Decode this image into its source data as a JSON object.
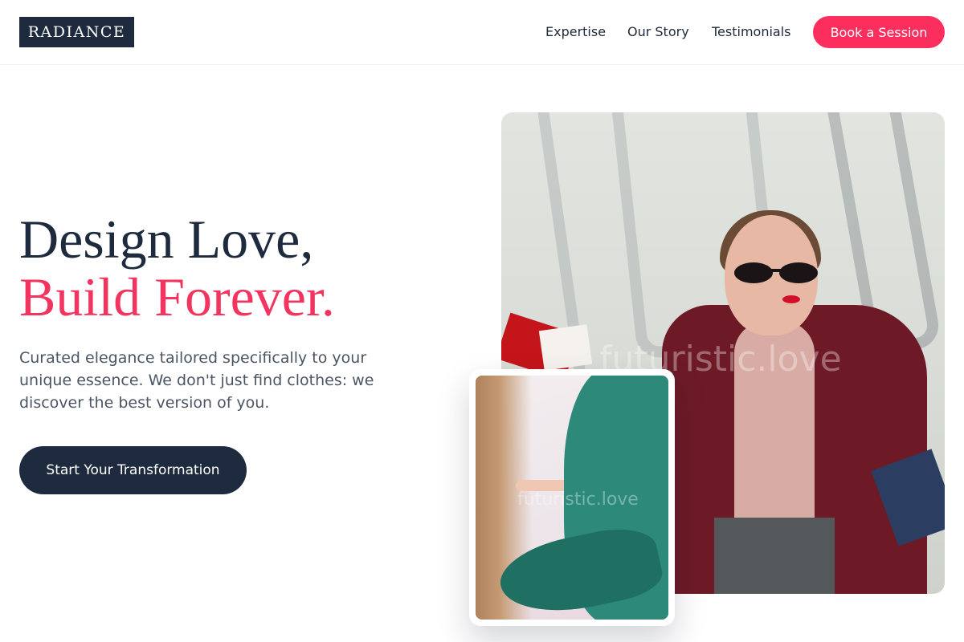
{
  "brand": {
    "logo_text": "RADIANCE"
  },
  "nav": {
    "items": [
      {
        "label": "Expertise"
      },
      {
        "label": "Our Story"
      },
      {
        "label": "Testimonials"
      }
    ],
    "cta_label": "Book a Session"
  },
  "hero": {
    "title_line1": "Design Love,",
    "title_line2": "Build Forever.",
    "subtitle": "Curated elegance tailored specifically to your unique essence. We don't just find clothes: we discover the best version of you.",
    "button_label": "Start Your Transformation"
  },
  "images": {
    "main_watermark": "futuristic.love",
    "inset_watermark": "futuristic.love"
  },
  "colors": {
    "navy": "#1e2a3e",
    "accent_pink": "#fb2e5e",
    "text_gray": "#4b5563"
  }
}
